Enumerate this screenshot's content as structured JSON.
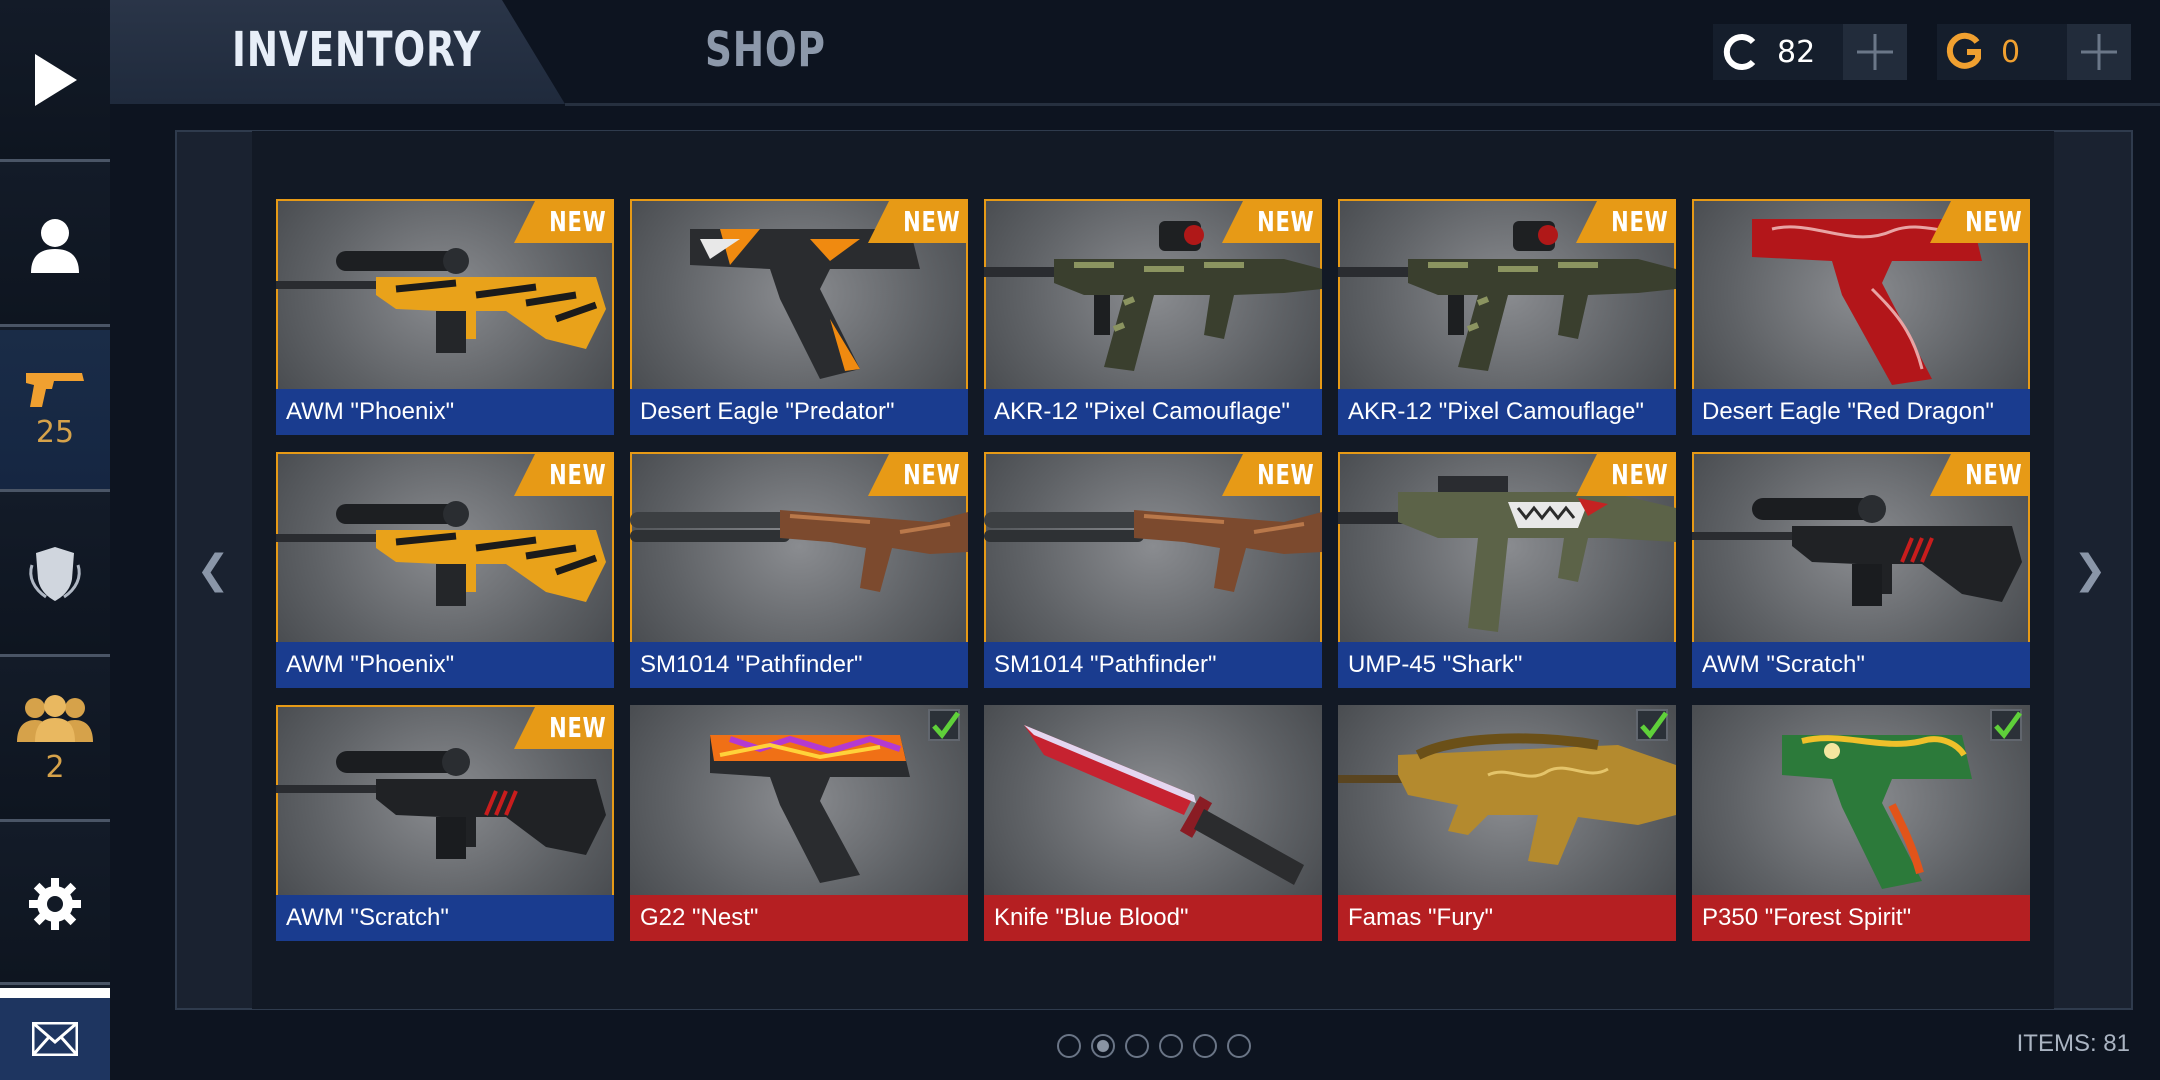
{
  "sidebar": {
    "items": [
      {
        "name": "play",
        "icon": "play-icon"
      },
      {
        "name": "profile",
        "icon": "user-icon"
      },
      {
        "name": "weapons",
        "icon": "pistol-icon",
        "count": "25"
      },
      {
        "name": "clan",
        "icon": "shield-icon"
      },
      {
        "name": "friends",
        "icon": "friends-icon",
        "count": "2"
      },
      {
        "name": "settings",
        "icon": "gear-icon"
      },
      {
        "name": "mail",
        "icon": "mail-icon"
      }
    ]
  },
  "header": {
    "tabs": [
      {
        "label": "INVENTORY",
        "active": true
      },
      {
        "label": "SHOP",
        "active": false
      }
    ],
    "currencies": [
      {
        "icon": "credits-icon",
        "amount": "82",
        "color": "#ffffff"
      },
      {
        "icon": "gold-icon",
        "amount": "0",
        "color": "#f0a030"
      }
    ]
  },
  "inventory": {
    "items": [
      {
        "name": "AWM \"Phoenix\"",
        "new": true,
        "rarity": "blue",
        "art": "sniper-phoenix"
      },
      {
        "name": "Desert Eagle \"Predator\"",
        "new": true,
        "rarity": "blue",
        "art": "deagle-predator"
      },
      {
        "name": "AKR-12 \"Pixel Camouflage\"",
        "new": true,
        "rarity": "blue",
        "art": "rifle-camo"
      },
      {
        "name": "AKR-12 \"Pixel Camouflage\"",
        "new": true,
        "rarity": "blue",
        "art": "rifle-camo"
      },
      {
        "name": "Desert Eagle \"Red Dragon\"",
        "new": true,
        "rarity": "blue",
        "art": "deagle-red"
      },
      {
        "name": "AWM \"Phoenix\"",
        "new": true,
        "rarity": "blue",
        "art": "sniper-phoenix"
      },
      {
        "name": "SM1014 \"Pathfinder\"",
        "new": true,
        "rarity": "blue",
        "art": "shotgun"
      },
      {
        "name": "SM1014 \"Pathfinder\"",
        "new": true,
        "rarity": "blue",
        "art": "shotgun"
      },
      {
        "name": "UMP-45 \"Shark\"",
        "new": true,
        "rarity": "blue",
        "art": "smg-shark"
      },
      {
        "name": "AWM \"Scratch\"",
        "new": true,
        "rarity": "blue",
        "art": "sniper-scratch"
      },
      {
        "name": "AWM \"Scratch\"",
        "new": true,
        "rarity": "blue",
        "art": "sniper-scratch"
      },
      {
        "name": "G22 \"Nest\"",
        "new": false,
        "rarity": "red",
        "equipped": true,
        "art": "pistol-nest"
      },
      {
        "name": "Knife \"Blue Blood\"",
        "new": false,
        "rarity": "red",
        "art": "knife"
      },
      {
        "name": "Famas \"Fury\"",
        "new": false,
        "rarity": "red",
        "equipped": true,
        "art": "famas-gold"
      },
      {
        "name": "P350 \"Forest Spirit\"",
        "new": false,
        "rarity": "red",
        "equipped": true,
        "art": "pistol-dragon"
      }
    ],
    "new_label": "NEW",
    "items_count": "ITEMS: 81",
    "pages": 6,
    "current_page": 2
  },
  "colors": {
    "accent_orange": "#e79a16",
    "rarity_blue": "#1a3c8f",
    "rarity_red": "#b51f22",
    "check_green": "#5fd03a"
  }
}
